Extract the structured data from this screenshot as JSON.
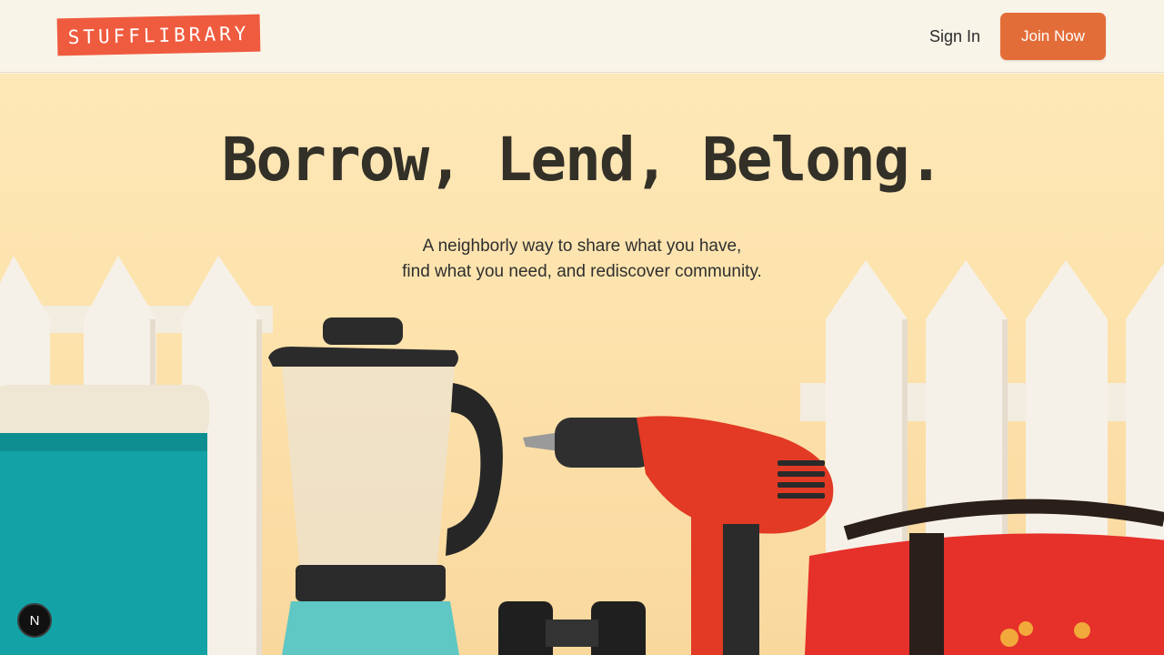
{
  "header": {
    "logo_text": "STUFFLIBRARY",
    "sign_in_label": "Sign In",
    "join_label": "Join Now"
  },
  "hero": {
    "title": "Borrow, Lend, Belong.",
    "subtitle_line1": "A neighborly way to share what you have,",
    "subtitle_line2": "find what you need, and rediscover community.",
    "image_items": [
      "picket-fence",
      "teal-cooler",
      "blender",
      "power-drill",
      "binoculars",
      "red-bag"
    ]
  },
  "overlay": {
    "badge_text": "N"
  },
  "colors": {
    "brand": "#ef5b3f",
    "accent": "#e36d38",
    "background": "#f9f4e8",
    "hero_bg": "#fde3ad"
  }
}
